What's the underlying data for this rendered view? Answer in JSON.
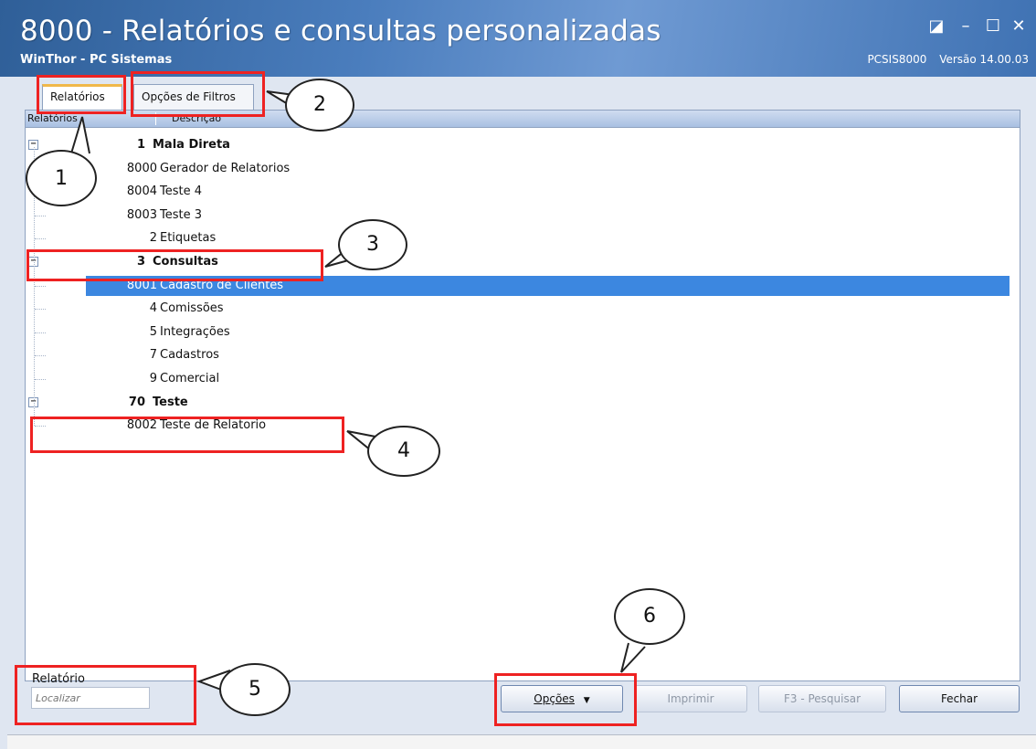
{
  "window": {
    "title": "8000 - Relatórios e consultas personalizadas",
    "subtitle": "WinThor - PC Sistemas",
    "routine_code": "PCSIS8000",
    "version": "Versão 14.00.03",
    "controls": [
      "restore-icon",
      "minimize-icon",
      "maximize-icon",
      "close-icon"
    ]
  },
  "tabs": [
    {
      "label": "Relatórios",
      "active": true
    },
    {
      "label": "Opções de Filtros",
      "active": false
    }
  ],
  "tree": {
    "columns": [
      "Relatórios",
      "Descrição"
    ],
    "rows": [
      {
        "code": "1",
        "label": "Mala Direta",
        "group": true
      },
      {
        "code": "8000",
        "label": "Gerador de Relatorios",
        "group": false
      },
      {
        "code": "8004",
        "label": "Teste 4",
        "group": false
      },
      {
        "code": "8003",
        "label": "Teste 3",
        "group": false
      },
      {
        "code": "2",
        "label": "Etiquetas",
        "group": false
      },
      {
        "code": "3",
        "label": "Consultas",
        "group": true
      },
      {
        "code": "8001",
        "label": "Cadastro de Clientes",
        "group": false,
        "selected": true
      },
      {
        "code": "4",
        "label": "Comissões",
        "group": false
      },
      {
        "code": "5",
        "label": "Integrações",
        "group": false
      },
      {
        "code": "7",
        "label": "Cadastros",
        "group": false
      },
      {
        "code": "9",
        "label": "Comercial",
        "group": false
      },
      {
        "code": "70",
        "label": "Teste",
        "group": true
      },
      {
        "code": "8002",
        "label": "Teste de Relatorio",
        "group": false
      }
    ]
  },
  "footer": {
    "report_label": "Relatório",
    "search_placeholder": "Localizar",
    "buttons": {
      "options": "Opções",
      "print": "Imprimir",
      "search": "F3 - Pesquisar",
      "close": "Fechar"
    }
  },
  "callouts": [
    "1",
    "2",
    "3",
    "4",
    "5",
    "6"
  ],
  "colors": {
    "highlight": "#ee2222",
    "selection": "#3c87e0",
    "titlebar": "#3f72b3"
  }
}
